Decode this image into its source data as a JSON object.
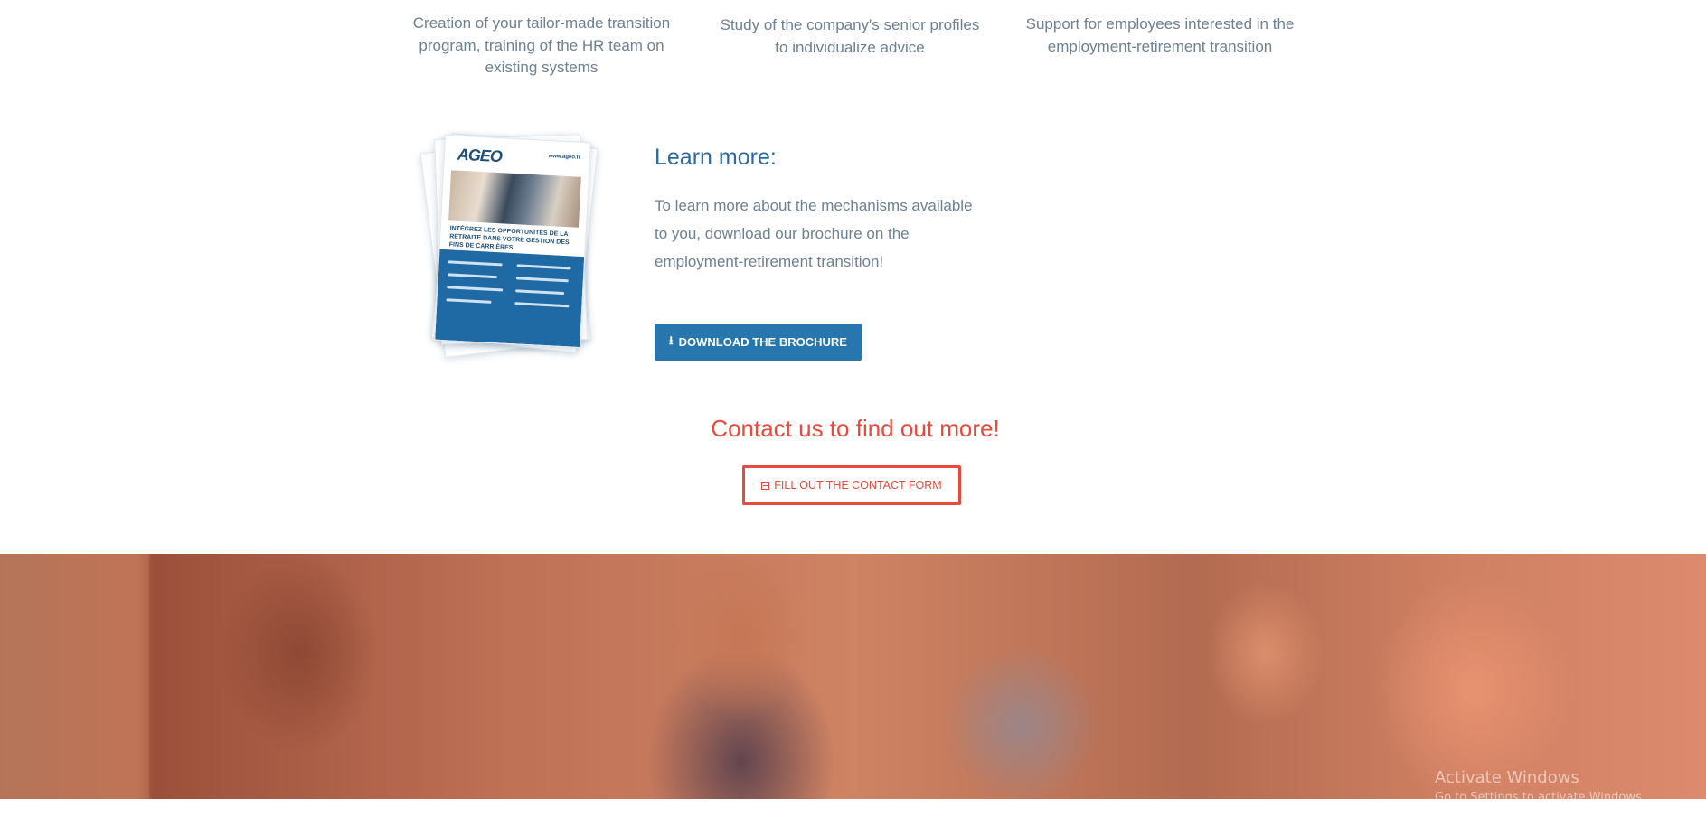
{
  "features": [
    {
      "text": "Creation of your tailor-made transition program, training of the HR team on existing systems"
    },
    {
      "text": "Study of the company's senior profiles to individualize advice"
    },
    {
      "text": "Support for employees interested in the employment-retirement transition"
    }
  ],
  "brochure": {
    "logo": "AGEO",
    "url": "www.ageo.fr",
    "headline": "INTÉGREZ LES OPPORTUNITÉS DE LA RETRAITE DANS VOTRE GESTION DES FINS DE CARRIÈRES"
  },
  "learn_more": {
    "title": "Learn more:",
    "text": "To learn more about the mechanisms available to you, download our brochure on the employment-retirement transition!",
    "download_icon": "download-icon",
    "download_label": "DOWNLOAD THE BROCHURE"
  },
  "contact": {
    "title": "Contact us to find out more!",
    "button_icon": "form-icon",
    "button_label": "FILL OUT THE CONTACT FORM"
  },
  "watermark": {
    "line1": "Activate Windows",
    "line2": "Go to Settings to activate Windows."
  },
  "colors": {
    "accent_blue": "#2777ae",
    "accent_red": "#e84a3c",
    "text_gray": "#6e8091"
  }
}
